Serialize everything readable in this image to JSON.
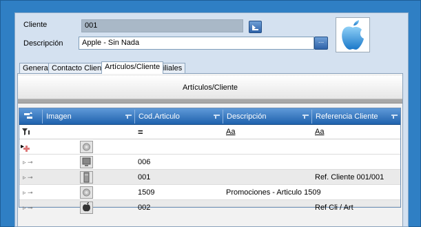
{
  "form": {
    "cliente_label": "Cliente",
    "cliente_value": "001",
    "descripcion_label": "Descripción",
    "descripcion_value": "Apple - Sin Nada",
    "lookup_button": "...",
    "logo": "apple-logo-icon"
  },
  "tabs": [
    {
      "label": "General",
      "active": false
    },
    {
      "label": "Contacto Cliente",
      "active": false
    },
    {
      "label": "Artículos/Cliente",
      "active": true
    },
    {
      "label": "Filiales",
      "active": false
    }
  ],
  "panel": {
    "title": "Artículos/Cliente"
  },
  "grid": {
    "columns": [
      {
        "key": "imagen",
        "label": "Imagen"
      },
      {
        "key": "cod",
        "label": "Cod.Articulo"
      },
      {
        "key": "desc",
        "label": "Descripción"
      },
      {
        "key": "ref",
        "label": "Referencia Cliente"
      }
    ],
    "filters": {
      "cod": "=",
      "desc": "Aa",
      "ref": "Aa"
    },
    "rows": [
      {
        "image": "gear-icon",
        "cod": "",
        "desc": "",
        "ref": ""
      },
      {
        "image": "monitor-icon",
        "cod": "006",
        "desc": "",
        "ref": ""
      },
      {
        "image": "server-icon",
        "cod": "001",
        "desc": "",
        "ref": "Ref. Cliente 001/001"
      },
      {
        "image": "gear-icon",
        "cod": "1509",
        "desc": "Promociones - Articulo 1509",
        "ref": ""
      },
      {
        "image": "apple-icon",
        "cod": "002",
        "desc": "",
        "ref": "Ref Cli / Art"
      }
    ]
  },
  "colors": {
    "frame_blue": "#2f7fc4",
    "header_blue": "#1f62ad",
    "form_bg": "#d4e1f0"
  }
}
